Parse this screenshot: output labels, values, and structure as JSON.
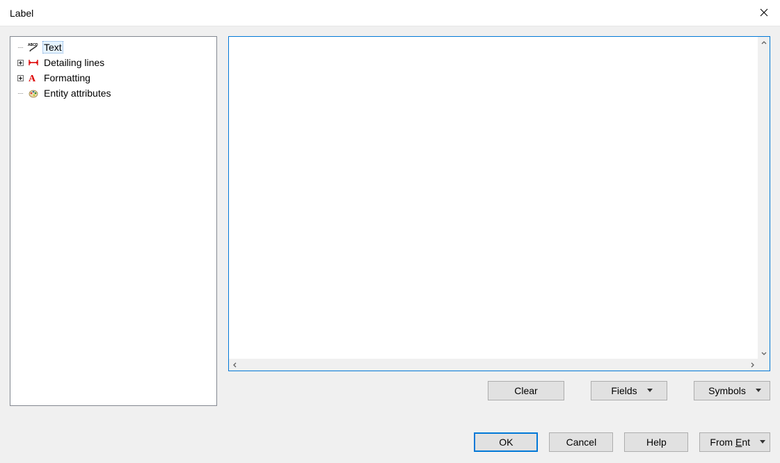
{
  "window": {
    "title": "Label"
  },
  "tree": {
    "items": [
      {
        "label": "Text",
        "icon": "text-annotation-icon",
        "expandable": false,
        "selected": true
      },
      {
        "label": "Detailing lines",
        "icon": "dimension-icon",
        "expandable": true,
        "selected": false
      },
      {
        "label": "Formatting",
        "icon": "format-a-icon",
        "expandable": true,
        "selected": false
      },
      {
        "label": "Entity attributes",
        "icon": "palette-icon",
        "expandable": false,
        "selected": false
      }
    ]
  },
  "editor": {
    "value": "",
    "placeholder": ""
  },
  "buttons_upper": {
    "clear": "Clear",
    "fields": "Fields",
    "symbols": "Symbols"
  },
  "buttons_lower": {
    "ok": "OK",
    "cancel": "Cancel",
    "help": "Help",
    "from_ent_prefix": "From ",
    "from_ent_u": "E",
    "from_ent_suffix": "nt"
  }
}
